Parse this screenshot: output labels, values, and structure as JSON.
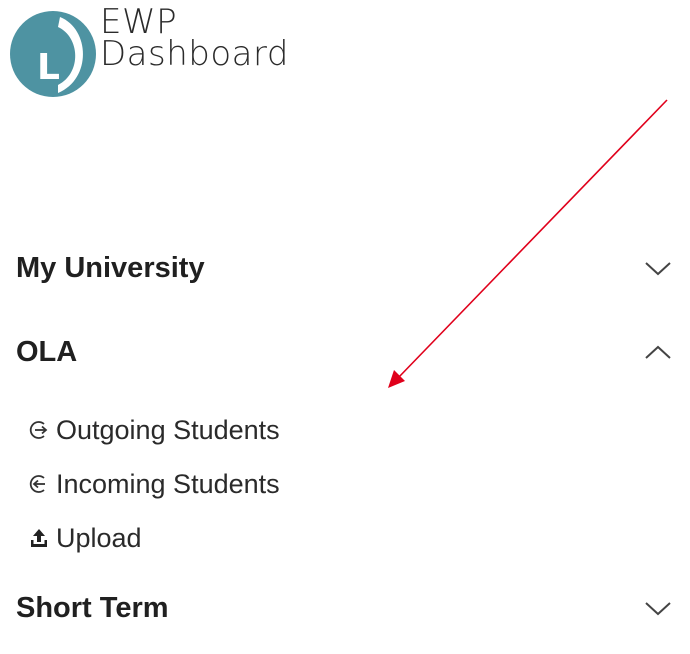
{
  "logo": {
    "line1": "EWP",
    "line2": "Dashboard",
    "mark_letter": "L",
    "colors": {
      "mark_fill": "#4e93a2",
      "mark_accent": "#ffffff"
    }
  },
  "nav": {
    "sections": [
      {
        "label": "My University",
        "expanded": false,
        "chevron": "chevron-down-icon"
      },
      {
        "label": "OLA",
        "expanded": true,
        "chevron": "chevron-up-icon",
        "items": [
          {
            "label": "Outgoing Students",
            "icon": "arrow-right-circle-icon"
          },
          {
            "label": "Incoming Students",
            "icon": "arrow-left-circle-icon"
          },
          {
            "label": "Upload",
            "icon": "upload-icon"
          }
        ]
      },
      {
        "label": "Short Term",
        "expanded": false,
        "chevron": "chevron-down-icon"
      }
    ]
  },
  "annotation": {
    "type": "red-arrow",
    "color": "#e0001b"
  }
}
